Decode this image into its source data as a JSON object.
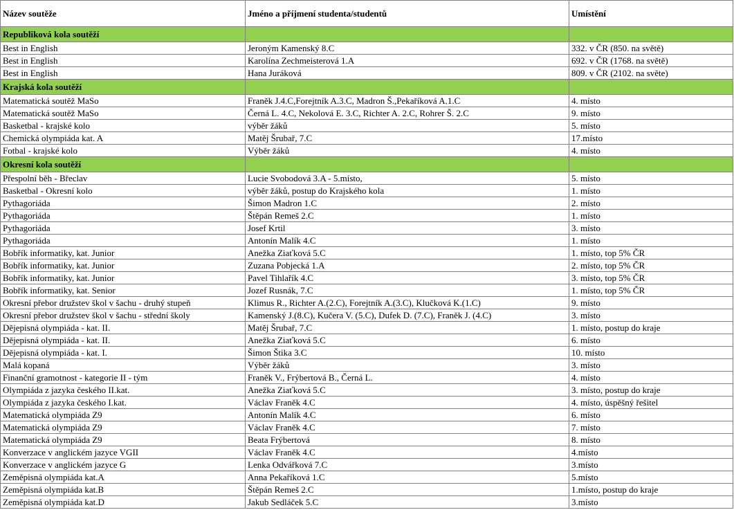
{
  "header": {
    "col1": "Název soutěže",
    "col2": "Jméno a příjmení studenta/studentů",
    "col3": "Umístění"
  },
  "colors": {
    "section_background": "#92d050",
    "border": "#7f7f7f"
  },
  "sections": [
    {
      "title": "Republiková kola soutěží",
      "rows": [
        [
          "Best in English",
          "Jeroným Kamenský 8.C",
          "332. v ČR (850. na světě)"
        ],
        [
          "Best in English",
          "Karolína Zechmeisterová 1.A",
          "692. v ČR (1768. na světě)"
        ],
        [
          "Best in English",
          "Hana Juráková",
          "809. v ČR (2102. na světe)"
        ]
      ]
    },
    {
      "title": "Krajská kola soutěží",
      "rows": [
        [
          "Matematická soutěž MaSo",
          "Franěk J.4.C,Forejtník A.3.C, Madron Š.,Pekaříková A.1.C",
          "4. místo"
        ],
        [
          "Matematická soutěž MaSo",
          "Černá L. 4.C, Nekolová E. 3.C, Richter A. 2.C, Rohrer Š. 2.C",
          "9. místo"
        ],
        [
          "Basketbal - krajské kolo",
          "výběr žáků",
          "5. místo"
        ],
        [
          "Chemická olympiáda kat. A",
          "Matěj Šrubař, 7.C",
          "17.místo"
        ],
        [
          "Fotbal - krajské kolo",
          "Výběr žáků",
          "4. místo"
        ]
      ]
    },
    {
      "title": "Okresní kola soutěží",
      "rows": [
        [
          "Přespolní běh - Břeclav",
          "Lucie Svobodová 3.A - 5.místo,",
          "5. místo"
        ],
        [
          "Basketbal - Okresní kolo",
          "výběr žáků, postup do Krajského kola",
          "1. místo"
        ],
        [
          "Pythagoriáda",
          "Šimon Madron 1.C",
          "2. místo"
        ],
        [
          "Pythagoriáda",
          "Štěpán Remeš 2.C",
          "1. místo"
        ],
        [
          "Pythagoriáda",
          "Josef Krtil",
          "3. místo"
        ],
        [
          "Pythagoriáda",
          "Antonín Malík 4.C",
          "1. místo"
        ],
        [
          "Bobřík informatiky, kat. Junior",
          "Anežka Ziaťková 5.C",
          "1. místo, top 5% ČR"
        ],
        [
          "Bobřík informatiky, kat. Junior",
          "Zuzana Pobjecká 1.A",
          "2. místo, top 5% ČR"
        ],
        [
          "Bobřík informatiky, kat. Junior",
          "Pavel Tihlařík 4.C",
          "3. místo, top 5% ČR"
        ],
        [
          "Bobřík informatiky, kat. Senior",
          "Jozef Rusnák, 7.C",
          "1. místo, top 5% ČR"
        ],
        [
          "Okresní přebor družstev škol v šachu - druhý stupeň",
          "Klimus R., Richter A.(2.C), Forejtník A.(3.C), Klučková K.(1.C)",
          "9. místo"
        ],
        [
          "Okresní přebor družstev škol v šachu - střední školy",
          "Kamenský J.(8.C), Kučera V. (5.C), Dufek D. (7.C), Franěk J. (4.C)",
          "3. místo"
        ],
        [
          "Dějepisná olympiáda - kat. II.",
          "Matěj Šrubař, 7.C",
          "1. místo, postup do kraje"
        ],
        [
          "Dějepisná olympiáda - kat. II.",
          "Anežka Ziaťková 5.C",
          "6. místo"
        ],
        [
          "Dějepisná olympiáda - kat. I.",
          "Šimon Štika 3.C",
          "10. místo"
        ],
        [
          "Malá kopaná",
          "Výběr žáků",
          "3. místo"
        ],
        [
          "Finanční gramotnost - kategorie II - tým",
          "Franěk V., Frýbertová B., Černá L.",
          "4. místo"
        ],
        [
          "Olympiáda z jazyka českého II.kat.",
          "Anežka Ziaťková 5.C",
          "3. místo, postup do kraje"
        ],
        [
          "Olympiáda z jazyka českého I.kat.",
          "Václav Franěk 4.C",
          "4. místo, úspěšný řešitel"
        ],
        [
          "Matematická olympiáda Z9",
          "Antonín Malík 4.C",
          "6. místo"
        ],
        [
          "Matematická olympiáda Z9",
          "Václav Franěk 4.C",
          "7. místo"
        ],
        [
          "Matematická olympiáda Z9",
          "Beata Frýbertová",
          "8. místo"
        ],
        [
          "Konverzace v anglickém jazyce VGII",
          "Václav Franěk 4.C",
          "4.místo"
        ],
        [
          "Konverzace v anglickém jazyce G",
          "Lenka Odvářková 7.C",
          "3.místo"
        ],
        [
          "Zeměpisná olympiáda kat.A",
          "Anna Pekaříková 1.C",
          "5.místo"
        ],
        [
          "Zeměpisná olympiáda kat.B",
          "Štěpán Remeš 2.C",
          "1.místo, postup do kraje"
        ],
        [
          "Zeměpisná olympiáda kat.D",
          "Jakub Sedláček 5.C",
          "3.místo"
        ]
      ]
    }
  ]
}
